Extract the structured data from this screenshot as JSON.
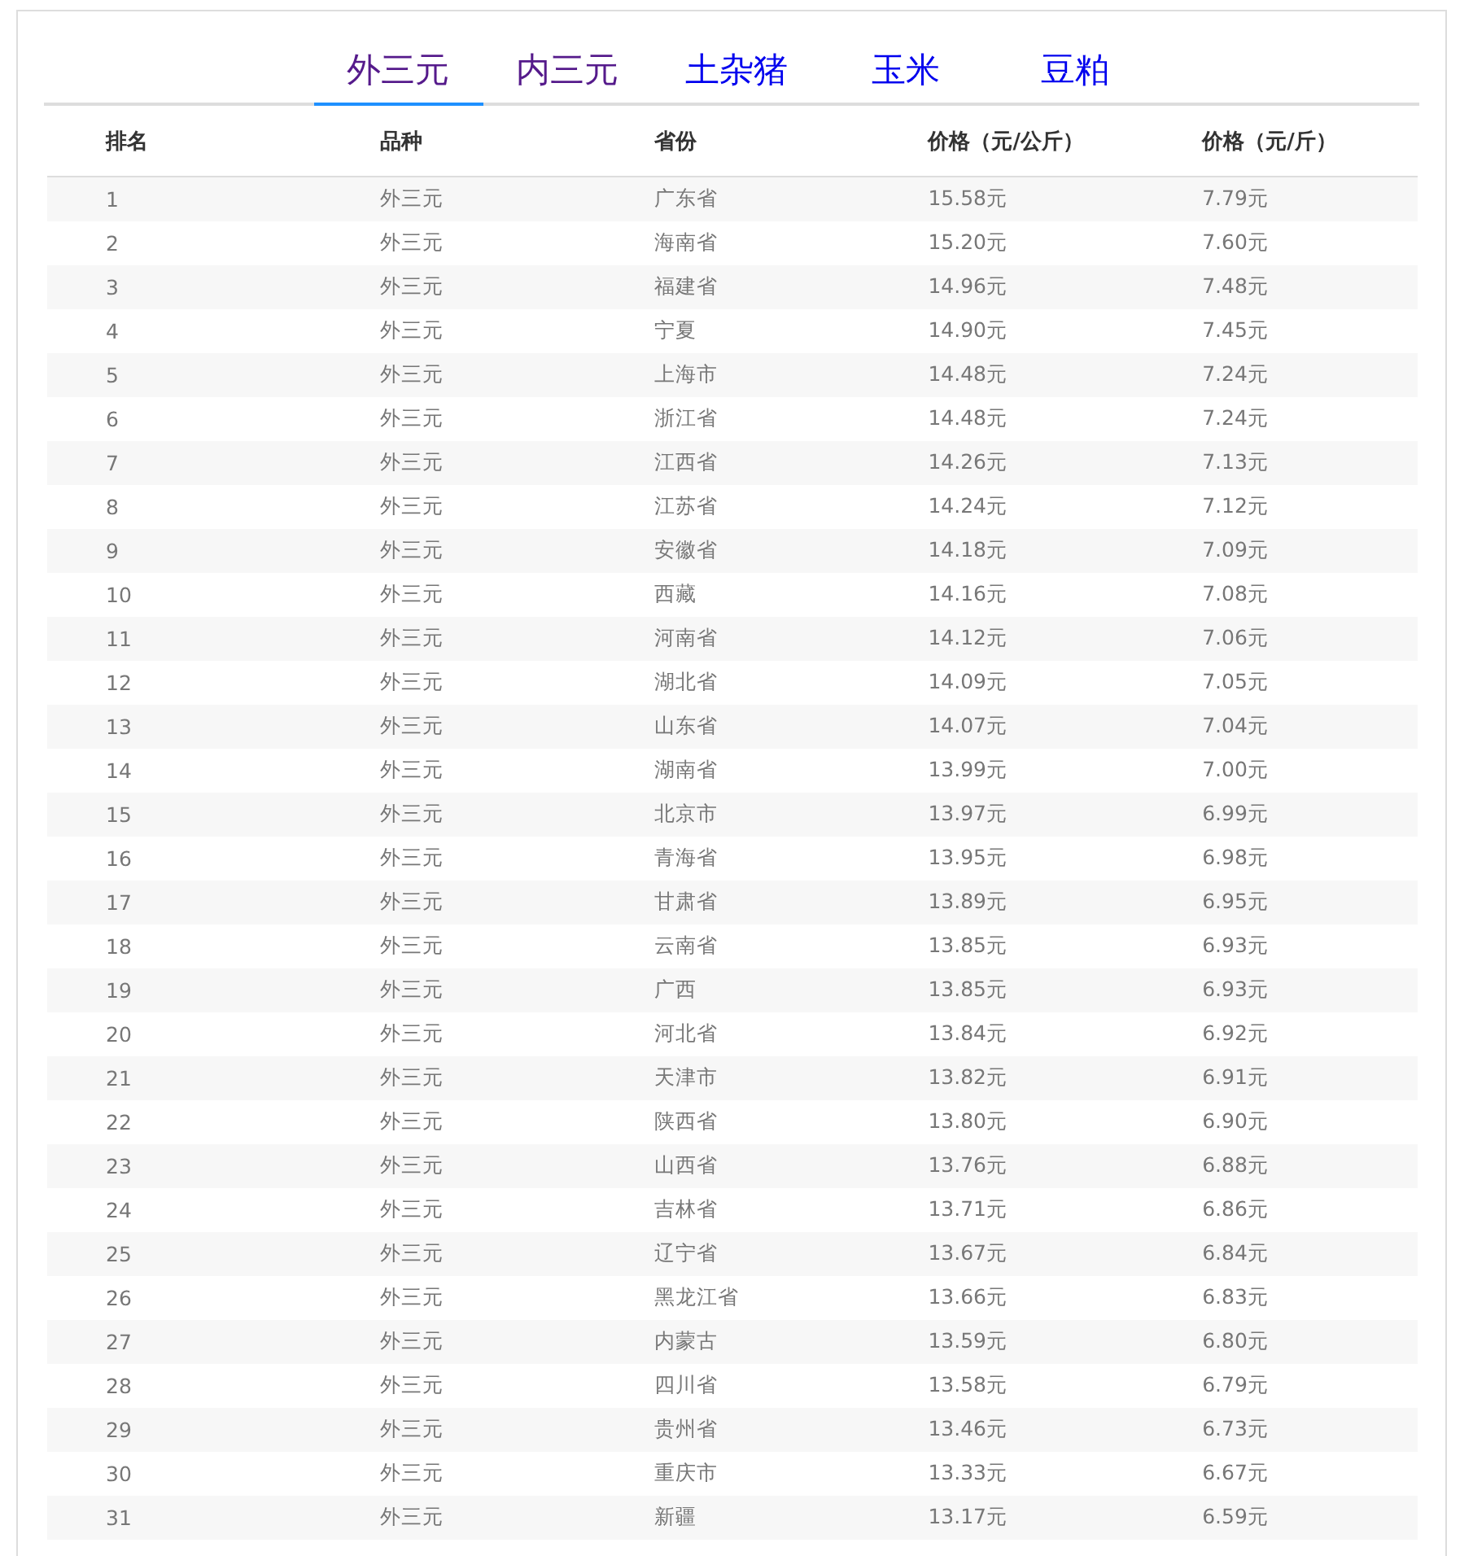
{
  "tabs": [
    {
      "label": "外三元",
      "selected": true,
      "visited": true
    },
    {
      "label": "内三元",
      "selected": false,
      "visited": true
    },
    {
      "label": "土杂猪",
      "selected": false,
      "visited": false
    },
    {
      "label": "玉米",
      "selected": false,
      "visited": false
    },
    {
      "label": "豆粕",
      "selected": false,
      "visited": false
    }
  ],
  "table": {
    "columns": [
      "排名",
      "品种",
      "省份",
      "价格（元/公斤）",
      "价格（元/斤）"
    ],
    "rows": [
      [
        "1",
        "外三元",
        "广东省",
        "15.58元",
        "7.79元"
      ],
      [
        "2",
        "外三元",
        "海南省",
        "15.20元",
        "7.60元"
      ],
      [
        "3",
        "外三元",
        "福建省",
        "14.96元",
        "7.48元"
      ],
      [
        "4",
        "外三元",
        "宁夏",
        "14.90元",
        "7.45元"
      ],
      [
        "5",
        "外三元",
        "上海市",
        "14.48元",
        "7.24元"
      ],
      [
        "6",
        "外三元",
        "浙江省",
        "14.48元",
        "7.24元"
      ],
      [
        "7",
        "外三元",
        "江西省",
        "14.26元",
        "7.13元"
      ],
      [
        "8",
        "外三元",
        "江苏省",
        "14.24元",
        "7.12元"
      ],
      [
        "9",
        "外三元",
        "安徽省",
        "14.18元",
        "7.09元"
      ],
      [
        "10",
        "外三元",
        "西藏",
        "14.16元",
        "7.08元"
      ],
      [
        "11",
        "外三元",
        "河南省",
        "14.12元",
        "7.06元"
      ],
      [
        "12",
        "外三元",
        "湖北省",
        "14.09元",
        "7.05元"
      ],
      [
        "13",
        "外三元",
        "山东省",
        "14.07元",
        "7.04元"
      ],
      [
        "14",
        "外三元",
        "湖南省",
        "13.99元",
        "7.00元"
      ],
      [
        "15",
        "外三元",
        "北京市",
        "13.97元",
        "6.99元"
      ],
      [
        "16",
        "外三元",
        "青海省",
        "13.95元",
        "6.98元"
      ],
      [
        "17",
        "外三元",
        "甘肃省",
        "13.89元",
        "6.95元"
      ],
      [
        "18",
        "外三元",
        "云南省",
        "13.85元",
        "6.93元"
      ],
      [
        "19",
        "外三元",
        "广西",
        "13.85元",
        "6.93元"
      ],
      [
        "20",
        "外三元",
        "河北省",
        "13.84元",
        "6.92元"
      ],
      [
        "21",
        "外三元",
        "天津市",
        "13.82元",
        "6.91元"
      ],
      [
        "22",
        "外三元",
        "陕西省",
        "13.80元",
        "6.90元"
      ],
      [
        "23",
        "外三元",
        "山西省",
        "13.76元",
        "6.88元"
      ],
      [
        "24",
        "外三元",
        "吉林省",
        "13.71元",
        "6.86元"
      ],
      [
        "25",
        "外三元",
        "辽宁省",
        "13.67元",
        "6.84元"
      ],
      [
        "26",
        "外三元",
        "黑龙江省",
        "13.66元",
        "6.83元"
      ],
      [
        "27",
        "外三元",
        "内蒙古",
        "13.59元",
        "6.80元"
      ],
      [
        "28",
        "外三元",
        "四川省",
        "13.58元",
        "6.79元"
      ],
      [
        "29",
        "外三元",
        "贵州省",
        "13.46元",
        "6.73元"
      ],
      [
        "30",
        "外三元",
        "重庆市",
        "13.33元",
        "6.67元"
      ],
      [
        "31",
        "外三元",
        "新疆",
        "13.17元",
        "6.59元"
      ]
    ]
  }
}
